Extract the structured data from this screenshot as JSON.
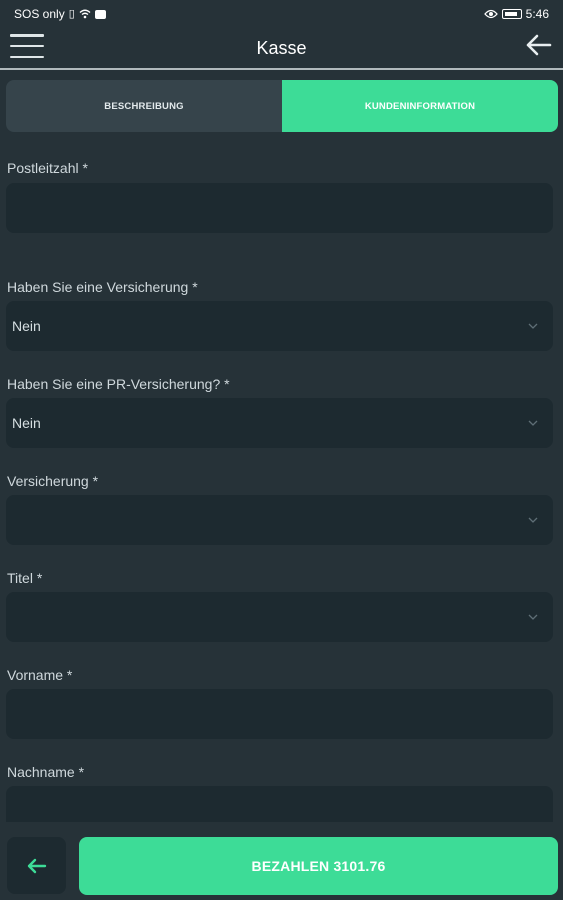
{
  "status_bar": {
    "carrier": "SOS only",
    "time": "5:46",
    "icons": [
      "sim-icon",
      "wifi-icon",
      "message-icon",
      "eye-icon",
      "battery-icon"
    ]
  },
  "app_bar": {
    "title": "Kasse",
    "menu_icon": "hamburger-menu-icon",
    "back_icon": "arrow-left-icon"
  },
  "tabs": [
    {
      "label": "BESCHREIBUNG",
      "active": false
    },
    {
      "label": "KUNDENINFORMATION",
      "active": true
    }
  ],
  "form": {
    "fields": [
      {
        "label": "Postleitzahl *",
        "type": "text",
        "value": ""
      },
      {
        "label": "Haben Sie eine Versicherung *",
        "type": "select",
        "value": "Nein"
      },
      {
        "label": "Haben Sie eine PR-Versicherung? *",
        "type": "select",
        "value": "Nein"
      },
      {
        "label": "Versicherung *",
        "type": "select",
        "value": ""
      },
      {
        "label": "Titel *",
        "type": "select",
        "value": ""
      },
      {
        "label": "Vorname *",
        "type": "text",
        "value": ""
      },
      {
        "label": "Nachname *",
        "type": "text",
        "value": ""
      }
    ]
  },
  "bottom_bar": {
    "back_icon": "arrow-left-icon",
    "pay_label": "BEZAHLEN 3101.76"
  },
  "colors": {
    "background": "#263238",
    "field_background": "#1d2a30",
    "accent": "#3ddc97",
    "tab_inactive": "#36444b"
  }
}
